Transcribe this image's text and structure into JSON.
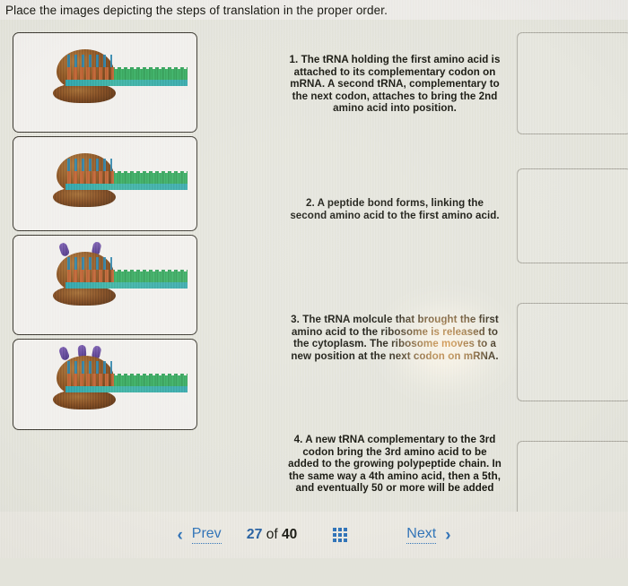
{
  "question": {
    "prompt": "Place the images depicting the steps of translation in the proper order."
  },
  "answer_bank": {
    "items": [
      {
        "alt": "Ribosome with mRNA strand and first tRNA attached"
      },
      {
        "alt": "Ribosome with mRNA strand and two tRNAs"
      },
      {
        "alt": "Ribosome with mRNA strand and purple tRNA leaving"
      },
      {
        "alt": "Ribosome with mRNA strand and growing polypeptide chain"
      }
    ]
  },
  "steps": [
    {
      "number": "1.",
      "text": "The tRNA holding the first amino acid is attached to its complementary codon on mRNA. A second tRNA, complementary to the next codon, attaches to bring the 2nd amino acid into position."
    },
    {
      "number": "2.",
      "text": "A peptide bond forms, linking the second amino acid to the first amino acid."
    },
    {
      "number": "3.",
      "text": "The tRNA molcule that brought the first amino acid to the ribosome is released to the cytoplasm. The ribosome moves to a new position at the next codon on mRNA."
    },
    {
      "number": "4.",
      "text": "A new tRNA complementary to the 3rd codon bring the 3rd amino acid to be added to the growing polypeptide chain. In the same way a 4th amino acid, then a 5th, and eventually 50 or more will be added"
    }
  ],
  "drop_zones": [
    {
      "label": ""
    },
    {
      "label": ""
    },
    {
      "label": ""
    },
    {
      "label": ""
    }
  ],
  "navigation": {
    "prev_label": "Prev",
    "next_label": "Next",
    "current_page": "27",
    "of_label": "of",
    "total_pages": "40",
    "grid_icon": "grid-icon",
    "prev_chevron": "‹",
    "next_chevron": "›"
  },
  "colors": {
    "page_background": "#e3e3da",
    "link_blue": "#2f6fb5",
    "text_dark": "#16160f",
    "glare_orange": "#ffb05c",
    "card_border": "#3a372f"
  }
}
